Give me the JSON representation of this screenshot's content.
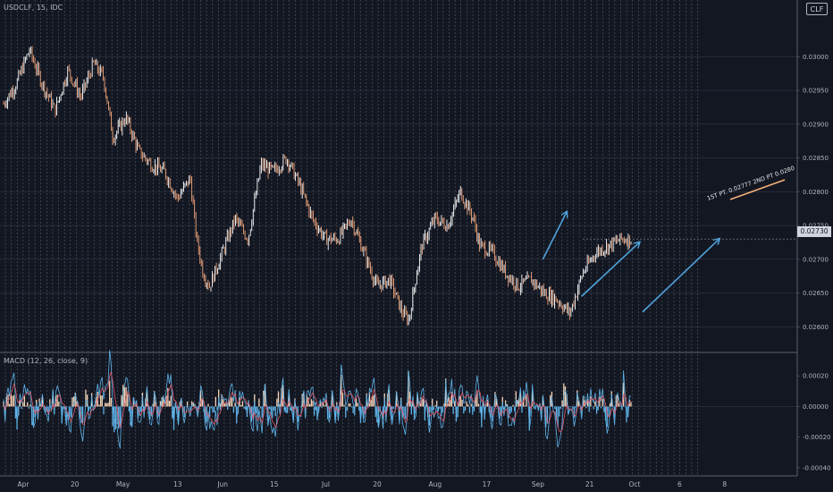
{
  "header": {
    "symbol_label": "USDCLF, 15, IDC",
    "badge": "CLF"
  },
  "indicator": {
    "label": "MACD (12, 26, close, 9)"
  },
  "annotation": {
    "text": "1ST PT. 0.02777 2ND PT 0.0280"
  },
  "colors": {
    "background": "#131722",
    "grid": "#c8ccd6",
    "axis_text": "#b2b5be",
    "price_line": "#e8c4a8",
    "candle_up": "#ffffff",
    "candle_down": "#f2a57a",
    "arrow": "#4fa3dc",
    "macd_line": "#5fb3e8",
    "signal_line": "#e05a6a",
    "hist_pos": "#f5d4b8",
    "hist_neg": "#5fb3e8",
    "annotation_line": "#f5b07a"
  },
  "chart_data": [
    {
      "type": "line",
      "title": "",
      "x_ticks": [
        "Apr",
        "20",
        "May",
        "13",
        "Jun",
        "15",
        "Jul",
        "20",
        "Aug",
        "17",
        "Sep",
        "21",
        "Oct",
        "6",
        "8"
      ],
      "x_tick_positions": [
        0,
        0.08,
        0.155,
        0.24,
        0.31,
        0.39,
        0.47,
        0.55,
        0.64,
        0.72,
        0.8,
        0.88,
        0.95,
        1.02,
        1.09
      ],
      "y_ticks": [
        "0.03000",
        "0.02950",
        "0.02900",
        "0.02850",
        "0.02800",
        "0.02750",
        "0.02700",
        "0.02650",
        "0.02600"
      ],
      "ylim": [
        0.0257,
        0.0306
      ],
      "last_price": "0.02730",
      "last_price_value": 0.0273,
      "x": [
        0,
        0.02,
        0.04,
        0.06,
        0.08,
        0.1,
        0.12,
        0.14,
        0.155,
        0.17,
        0.19,
        0.21,
        0.23,
        0.25,
        0.27,
        0.29,
        0.3,
        0.31,
        0.32,
        0.34,
        0.36,
        0.38,
        0.4,
        0.42,
        0.44,
        0.46,
        0.48,
        0.5,
        0.52,
        0.54,
        0.56,
        0.58,
        0.6,
        0.62,
        0.63,
        0.64,
        0.65,
        0.67,
        0.69,
        0.71,
        0.73,
        0.74,
        0.76,
        0.78,
        0.8,
        0.82,
        0.84,
        0.86,
        0.88,
        0.89,
        0.9,
        0.92,
        0.94,
        0.96,
        0.975
      ],
      "values": [
        0.0293,
        0.0296,
        0.0301,
        0.0296,
        0.0292,
        0.0298,
        0.0294,
        0.0299,
        0.0297,
        0.0288,
        0.0291,
        0.0286,
        0.0284,
        0.0283,
        0.0279,
        0.0282,
        0.0273,
        0.0268,
        0.0266,
        0.0271,
        0.0276,
        0.0273,
        0.0284,
        0.0283,
        0.0285,
        0.0281,
        0.0276,
        0.0273,
        0.0273,
        0.0276,
        0.0271,
        0.0266,
        0.0267,
        0.0262,
        0.0261,
        0.0267,
        0.0272,
        0.0276,
        0.0275,
        0.028,
        0.0276,
        0.0272,
        0.0271,
        0.0268,
        0.0266,
        0.0267,
        0.0265,
        0.0264,
        0.0262,
        0.0265,
        0.0268,
        0.0271,
        0.0272,
        0.0273,
        0.0273
      ]
    },
    {
      "type": "line",
      "title": "",
      "y_ticks": [
        "0.00020",
        "0.00000",
        "-0.00020",
        "-0.00040"
      ],
      "ylim": [
        -0.00043,
        0.00033
      ]
    }
  ]
}
